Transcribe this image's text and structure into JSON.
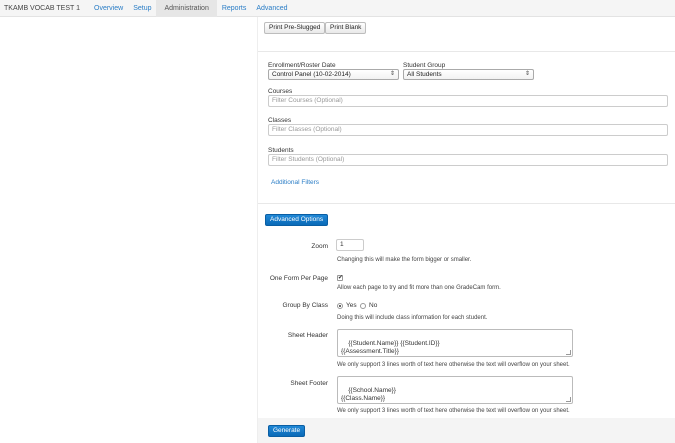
{
  "topnav": {
    "brand": "TKAMB VOCAB TEST 1",
    "items": [
      "Overview",
      "Setup",
      "Administration",
      "Reports",
      "Advanced"
    ]
  },
  "print": {
    "pre_slugged": "Print Pre-Slugged",
    "blank": "Print Blank"
  },
  "filters": {
    "enrollment_label": "Enrollment/Roster Date",
    "enrollment_value": "Control Panel (10-02-2014)",
    "group_label": "Student Group",
    "group_value": "All Students",
    "courses_label": "Courses",
    "courses_placeholder": "Filter Courses (Optional)",
    "classes_label": "Classes",
    "classes_placeholder": "Filter Classes (Optional)",
    "students_label": "Students",
    "students_placeholder": "Filter Students (Optional)",
    "additional": "Additional Filters",
    "arrows": "⇕"
  },
  "advanced": {
    "button": "Advanced Options",
    "zoom_label": "Zoom",
    "zoom_value": "1",
    "zoom_help": "Changing this will make the form bigger or smaller.",
    "one_form_label": "One Form Per Page",
    "one_form_checked": "✔",
    "one_form_help": "Allow each page to try and fit more than one GradeCam form.",
    "group_by_label": "Group By Class",
    "group_yes": "Yes",
    "group_no": "No",
    "group_help": "Doing this will include class information for each student.",
    "header_label": "Sheet Header",
    "header_value": "{{Student.Name}} {{Student.ID}}\n{{Assessment.Title}}",
    "header_help": "We only support 3 lines worth of text here otherwise the text will overflow on your sheet.",
    "footer_label": "Sheet Footer",
    "footer_value": "{{School.Name}}\n{{Class.Name}}",
    "footer_help": "We only support 3 lines worth of text here otherwise the text will overflow on your sheet."
  },
  "generate": "Generate"
}
